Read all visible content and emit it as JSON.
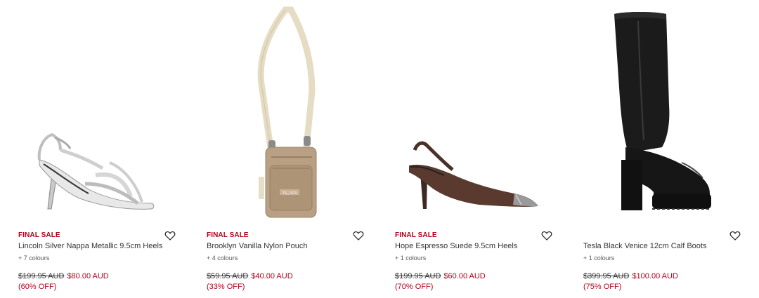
{
  "products": [
    {
      "badge": "FINAL SALE",
      "name": "Lincoln Silver Nappa Metallic 9.5cm Heels",
      "colours": "+ 7 colours",
      "old_price": "$199.95 AUD",
      "new_price": "$80.00 AUD",
      "discount": "(60% OFF)",
      "image": "silver-strappy-heel"
    },
    {
      "badge": "FINAL SALE",
      "name": "Brooklyn Vanilla Nylon Pouch",
      "colours": "+ 4 colours",
      "old_price": "$59.95 AUD",
      "new_price": "$40.00 AUD",
      "discount": "(33% OFF)",
      "image": "beige-crossbody-pouch"
    },
    {
      "badge": "FINAL SALE",
      "name": "Hope Espresso Suede 9.5cm Heels",
      "colours": "+ 1 colours",
      "old_price": "$199.95 AUD",
      "new_price": "$60.00 AUD",
      "discount": "(70% OFF)",
      "image": "brown-slingback-heel"
    },
    {
      "badge": "",
      "name": "Tesla Black Venice 12cm Calf Boots",
      "colours": "+ 1 colours",
      "old_price": "$399.95 AUD",
      "new_price": "$100.00 AUD",
      "discount": "(75% OFF)",
      "image": "black-platform-boot"
    }
  ],
  "colors": {
    "sale_red": "#b3001b",
    "text": "#333333"
  },
  "icons": {
    "wishlist": "heart-outline-icon"
  }
}
